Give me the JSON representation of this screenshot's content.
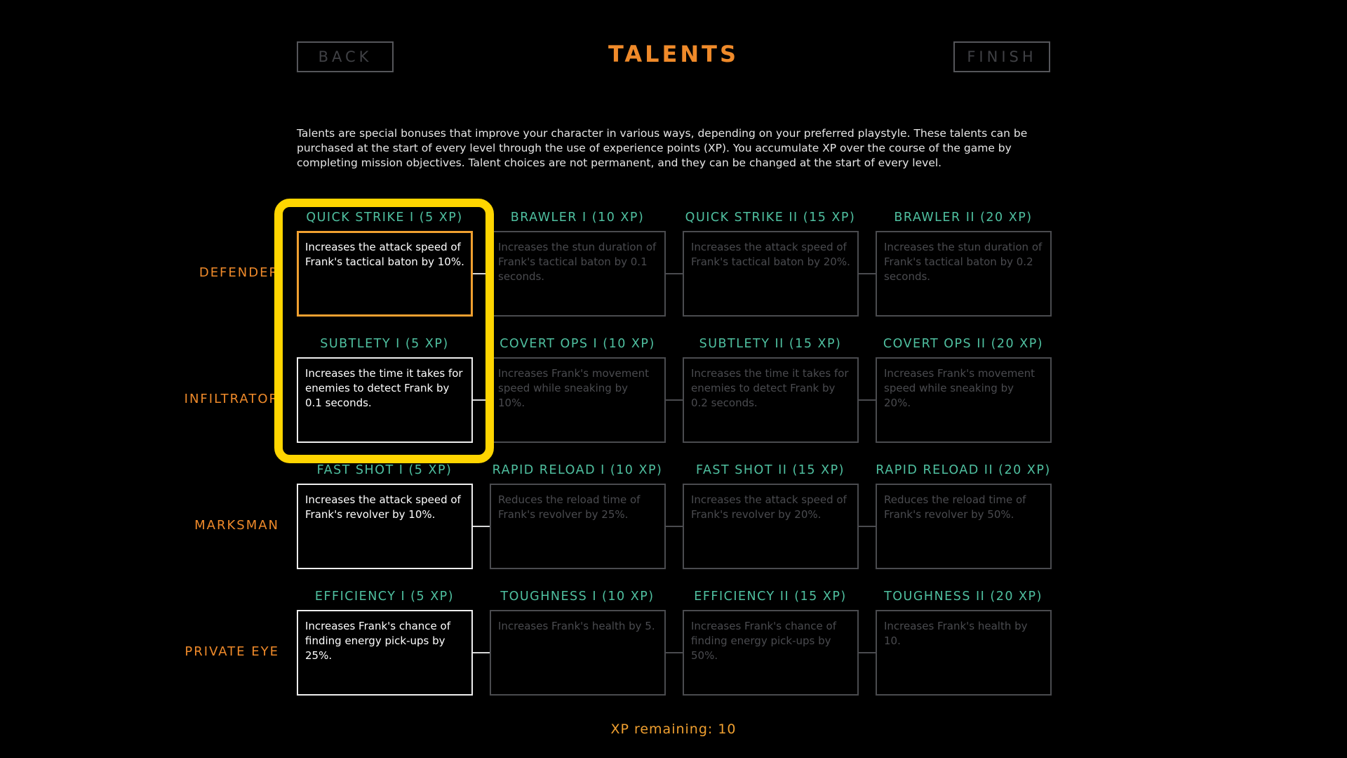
{
  "header": {
    "back_label": "BACK",
    "title": "TALENTS",
    "finish_label": "FINISH"
  },
  "description": "Talents are special bonuses that improve your character in various ways, depending on your preferred playstyle. These talents can be purchased at the start of every level through the use of experience points (XP). You accumulate XP over the course of the game by completing mission objectives. Talent choices are not permanent, and they can be changed at the start of every level.",
  "rows": [
    {
      "label": "DEFENDER",
      "talents": [
        {
          "title": "QUICK STRIKE I (5 XP)",
          "desc": "Increases the attack speed of Frank's tactical baton by 10%."
        },
        {
          "title": "BRAWLER I (10 XP)",
          "desc": "Increases the stun duration of Frank's tactical baton by 0.1 seconds."
        },
        {
          "title": "QUICK STRIKE II (15 XP)",
          "desc": "Increases the attack speed of Frank's tactical baton by 20%."
        },
        {
          "title": "BRAWLER II (20 XP)",
          "desc": "Increases the stun duration of Frank's tactical baton by 0.2 seconds."
        }
      ]
    },
    {
      "label": "INFILTRATOR",
      "talents": [
        {
          "title": "SUBTLETY I (5 XP)",
          "desc": "Increases the time it takes for enemies to detect Frank by 0.1 seconds."
        },
        {
          "title": "COVERT OPS I (10 XP)",
          "desc": "Increases Frank's movement speed while sneaking by 10%."
        },
        {
          "title": "SUBTLETY II (15 XP)",
          "desc": "Increases the time it takes for enemies to detect Frank by 0.2 seconds."
        },
        {
          "title": "COVERT OPS II (20 XP)",
          "desc": "Increases Frank's movement speed while sneaking by 20%."
        }
      ]
    },
    {
      "label": "MARKSMAN",
      "talents": [
        {
          "title": "FAST SHOT I (5 XP)",
          "desc": "Increases the attack speed of Frank's revolver by 10%."
        },
        {
          "title": "RAPID RELOAD I (10 XP)",
          "desc": "Reduces the reload time of Frank's revolver by 25%."
        },
        {
          "title": "FAST SHOT II (15 XP)",
          "desc": "Increases the attack speed of Frank's revolver by 20%."
        },
        {
          "title": "RAPID RELOAD II (20 XP)",
          "desc": "Reduces the reload time of Frank's revolver by 50%."
        }
      ]
    },
    {
      "label": "PRIVATE EYE",
      "talents": [
        {
          "title": "EFFICIENCY I (5 XP)",
          "desc": "Increases Frank's chance of finding energy pick-ups by 25%."
        },
        {
          "title": "TOUGHNESS I (10 XP)",
          "desc": "Increases Frank's health by 5."
        },
        {
          "title": "EFFICIENCY II (15 XP)",
          "desc": "Increases Frank's chance of finding energy pick-ups by 50%."
        },
        {
          "title": "TOUGHNESS II (20 XP)",
          "desc": "Increases Frank's health by 10."
        }
      ]
    }
  ],
  "footer": {
    "xp_text": "XP remaining: 10"
  },
  "colors": {
    "accent_orange": "#ef8a2a",
    "talent_title_teal": "#4fc0a0",
    "highlight_yellow": "#ffd500",
    "selected_border": "#f0a030"
  }
}
